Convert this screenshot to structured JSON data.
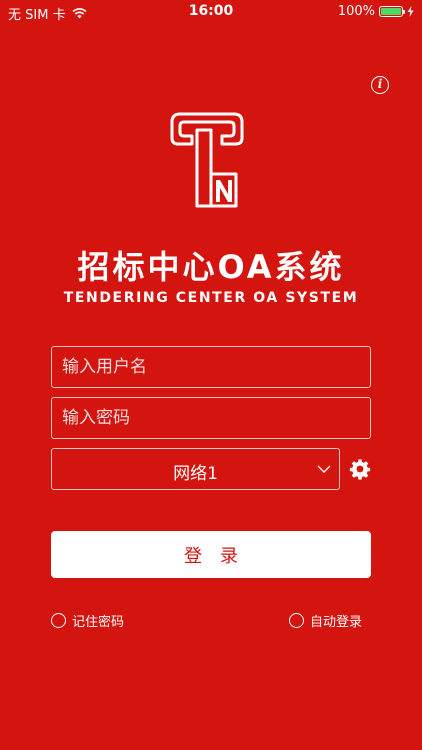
{
  "status_bar": {
    "carrier": "无 SIM 卡",
    "time": "16:00",
    "battery": "100%"
  },
  "app": {
    "title": "招标中心OA系统",
    "subtitle": "TENDERING CENTER OA SYSTEM"
  },
  "form": {
    "username_placeholder": "输入用户名",
    "password_placeholder": "输入密码",
    "network_value": "网络1",
    "login_label": "登录",
    "remember_label": "记住密码",
    "auto_login_label": "自动登录"
  },
  "colors": {
    "background": "#d4140f",
    "button_bg": "#ffffff",
    "button_text": "#d4140f",
    "battery": "#4cd964"
  },
  "icons": [
    "wifi-icon",
    "battery-icon",
    "charging-icon",
    "info-icon",
    "app-logo",
    "chevron-down-icon",
    "gear-icon"
  ]
}
